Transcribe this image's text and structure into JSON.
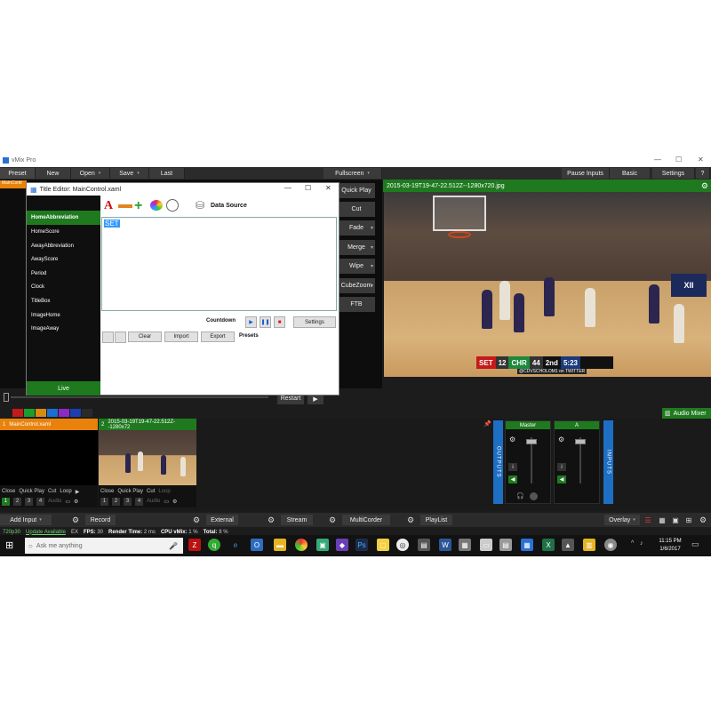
{
  "app": {
    "title": "vMix Pro"
  },
  "menu": {
    "preset": "Preset",
    "new": "New",
    "open": "Open",
    "save": "Save",
    "last": "Last",
    "fullscreen": "Fullscreen",
    "pause_inputs": "Pause Inputs",
    "basic": "Basic",
    "settings": "Settings",
    "help": "?"
  },
  "preview": {
    "tab_label": "MainContr"
  },
  "transitions": [
    "Quick Play",
    "Cut",
    "Fade",
    "Merge",
    "Wipe",
    "CubeZoom",
    "FTB"
  ],
  "output": {
    "title": "2015-03-19T19-47-22.512Z--1280x720.jpg",
    "scorebug": {
      "team_a": "SET",
      "score_a": "12",
      "team_b": "CHR",
      "score_b": "44",
      "period": "2nd",
      "clock": "5:23",
      "handle": "@CDVSCHOLOM1 on TWITTER"
    },
    "crest": "XII"
  },
  "playback": {
    "restart": "Restart"
  },
  "swatch_colors": [
    "#c41a1a",
    "#1c9e2d",
    "#d98a12",
    "#1b6fd0",
    "#8b2bc4",
    "#1c3fb0",
    "#2a2a2a"
  ],
  "audio_mixer": {
    "label": "Audio Mixer"
  },
  "inputs": [
    {
      "number": "1",
      "name": "MainControl.xaml",
      "color": "#e8820c",
      "buttons": [
        "Close",
        "Quick Play",
        "Cut",
        "Loop"
      ],
      "audio": "Audio",
      "nums": [
        "1",
        "2",
        "3",
        "4"
      ]
    },
    {
      "number": "2",
      "name": "2015-03-19T19-47-22.512Z--1280x72",
      "color": "#1f7a1f",
      "buttons": [
        "Close",
        "Quick Play",
        "Cut",
        "Loop"
      ],
      "audio": "Audio",
      "nums": [
        "1",
        "2",
        "3",
        "4"
      ]
    }
  ],
  "mixer": {
    "outputs_label": "OUTPUTS",
    "inputs_label": "INPUTS",
    "master": "Master",
    "a": "A"
  },
  "bottombar": {
    "add_input": "Add Input",
    "record": "Record",
    "external": "External",
    "stream": "Stream",
    "multicorder": "MultiCorder",
    "playlist": "PlayList",
    "overlay": "Overlay"
  },
  "status": {
    "resolution": "720p30",
    "update": "Update Available",
    "ex": "EX",
    "fps_label": "FPS:",
    "fps": "30",
    "render_label": "Render Time:",
    "render": "2 ms",
    "cpu_label": "CPU vMix:",
    "cpu": "1 %",
    "total_label": "Total:",
    "total": "8 %"
  },
  "taskbar": {
    "search_placeholder": "Ask me anything",
    "time": "11:15 PM",
    "date": "1/6/2017"
  },
  "title_editor": {
    "title": "Title Editor: MainControl.xaml",
    "items": [
      "HomeAbbreviation",
      "HomeScore",
      "AwayAbbreviation",
      "AwayScore",
      "Period",
      "Clock",
      "TitleBox",
      "ImageHome",
      "ImageAway"
    ],
    "data_source": "Data Source",
    "text_value": "SET",
    "countdown": "Countdown",
    "settings": "Settings",
    "clear": "Clear",
    "import": "Import",
    "export": "Export",
    "presets": "Presets",
    "live": "Live"
  }
}
